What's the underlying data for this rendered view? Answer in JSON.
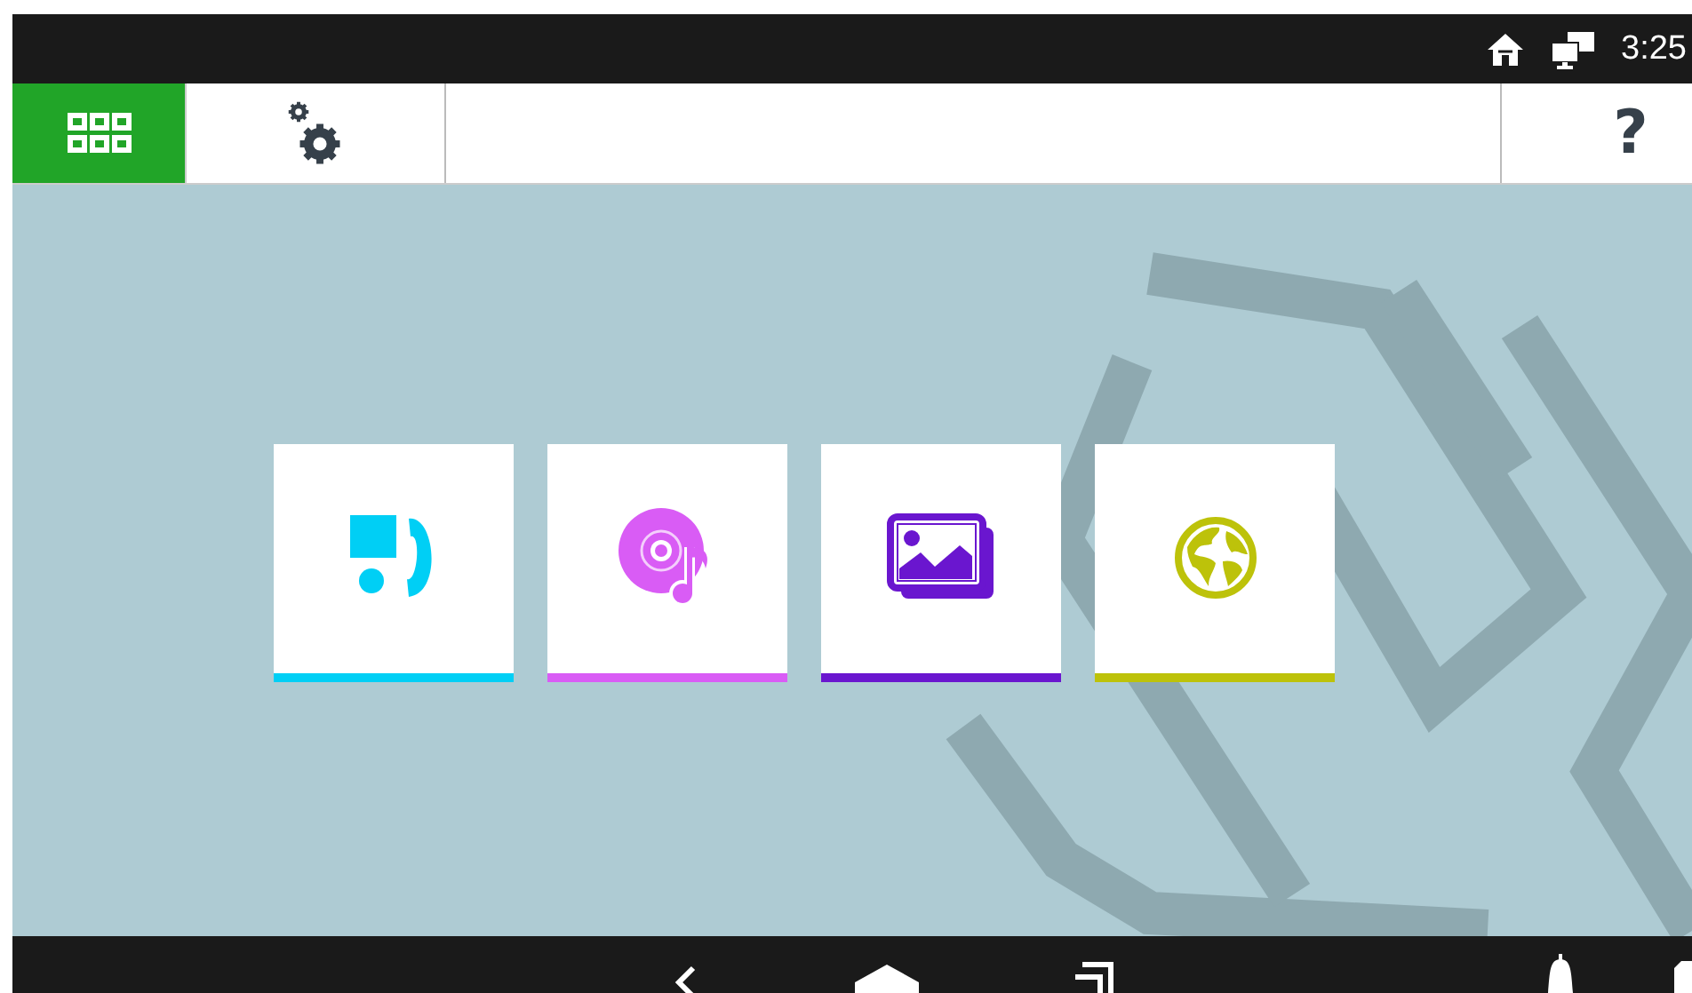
{
  "status_bar": {
    "time": "3:25"
  },
  "toolbar": {
    "apps_button": {
      "selected": true
    },
    "help": "?"
  },
  "tiles": [
    {
      "kind": "fax",
      "color": "#00cff5"
    },
    {
      "kind": "music",
      "color": "#d95cf5"
    },
    {
      "kind": "photos",
      "color": "#6a16cf"
    },
    {
      "kind": "web",
      "color": "#bdc20a"
    }
  ]
}
